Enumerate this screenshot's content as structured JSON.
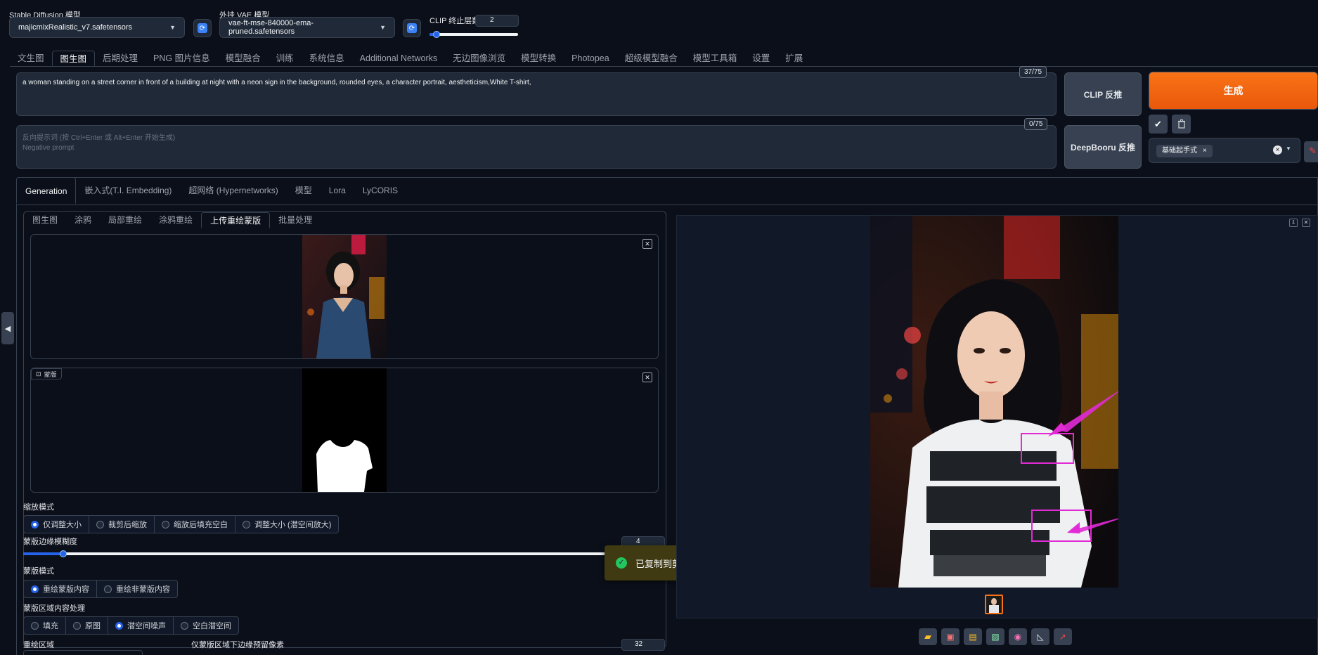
{
  "header": {
    "sd_model_label": "Stable Diffusion 模型",
    "sd_model_value": "majicmixRealistic_v7.safetensors",
    "vae_label": "外挂 VAE 模型",
    "vae_value": "vae-ft-mse-840000-ema-pruned.safetensors",
    "clip_label": "CLIP 终止层数",
    "clip_value": "2",
    "clip_slider_fraction": 0.08
  },
  "main_tabs": [
    "文生图",
    "图生图",
    "后期处理",
    "PNG 图片信息",
    "模型融合",
    "训练",
    "系统信息",
    "Additional Networks",
    "无边图像浏览",
    "模型转换",
    "Photopea",
    "超级模型融合",
    "模型工具箱",
    "设置",
    "扩展"
  ],
  "main_tab_active": 1,
  "prompt": {
    "positive_text": "a woman standing on a street corner in front of a building at night with a neon sign in the background, rounded eyes, a character portrait, aestheticism,White T-shirt,",
    "positive_counter": "37/75",
    "negative_placeholder_line1": "反向提示词 (按 Ctrl+Enter 或 Alt+Enter 开始生成)",
    "negative_placeholder_line2": "Negative prompt",
    "negative_counter": "0/75"
  },
  "actions": {
    "clip_interrogate": "CLIP 反推",
    "deepbooru_interrogate": "DeepBooru 反推",
    "generate": "生成",
    "style_chip": "基础起手式"
  },
  "sub_tabs": [
    "Generation",
    "嵌入式(T.I. Embedding)",
    "超网络 (Hypernetworks)",
    "模型",
    "Lora",
    "LyCORIS"
  ],
  "sub_tab_active": 0,
  "img2img_tabs": [
    "图生图",
    "涂鸦",
    "局部重绘",
    "涂鸦重绘",
    "上传重绘蒙版",
    "批量处理"
  ],
  "img2img_tab_active": 4,
  "mask_label": "蒙版",
  "resize_mode": {
    "label": "缩放模式",
    "options": [
      "仅调整大小",
      "裁剪后缩放",
      "缩放后填充空白",
      "调整大小 (潜空间放大)"
    ],
    "selected": 0
  },
  "mask_blur": {
    "label": "蒙版边缘模糊度",
    "value": "4",
    "max": 64
  },
  "mask_mode": {
    "label": "蒙版模式",
    "options": [
      "重绘蒙版内容",
      "重绘非蒙版内容"
    ],
    "selected": 0
  },
  "masked_content": {
    "label": "蒙版区域内容处理",
    "options": [
      "填充",
      "原图",
      "潜空间噪声",
      "空白潜空间"
    ],
    "selected": 2
  },
  "inpaint_area_label": "重绘区域",
  "padding": {
    "label": "仅蒙版区域下边缘预留像素",
    "value": "32"
  },
  "toast": {
    "text": "已复制到剪贴板。"
  },
  "colors": {
    "accent": "#f97316",
    "annotation": "#e22ad6",
    "toast_bg": "#3f3a12",
    "toast_icon": "#22c55e"
  }
}
